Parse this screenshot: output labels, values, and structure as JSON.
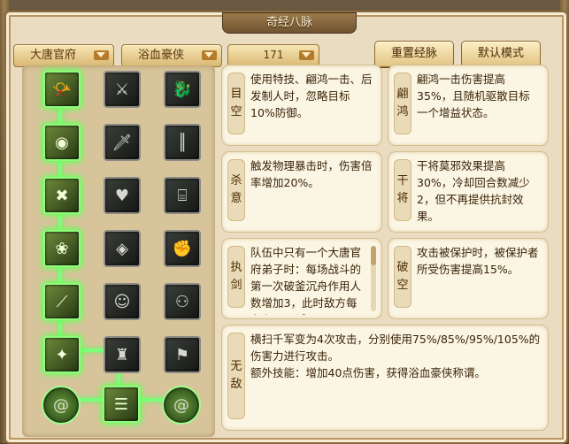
{
  "window": {
    "title": "奇经八脉"
  },
  "controls": {
    "sect": "大唐官府",
    "school": "浴血豪侠",
    "points": "171",
    "reset_label": "重置经脉",
    "default_label": "默认模式"
  },
  "grid": {
    "rows": [
      [
        {
          "icon": "horn-icon",
          "on": true
        },
        {
          "icon": "warrior-icon",
          "on": false
        },
        {
          "icon": "dragon-icon",
          "on": false
        }
      ],
      [
        {
          "icon": "eye-icon",
          "on": true
        },
        {
          "icon": "blade-icon",
          "on": false
        },
        {
          "icon": "bamboo-icon",
          "on": false
        }
      ],
      [
        {
          "icon": "sword-cross-icon",
          "on": true
        },
        {
          "icon": "heart-icon",
          "on": false
        },
        {
          "icon": "maze-icon",
          "on": false
        }
      ],
      [
        {
          "icon": "lotus-icon",
          "on": true
        },
        {
          "icon": "courage-icon",
          "on": false
        },
        {
          "icon": "grip-icon",
          "on": false
        }
      ],
      [
        {
          "icon": "slash-icon",
          "on": true
        },
        {
          "icon": "scholar-icon",
          "on": false
        },
        {
          "icon": "spirit-icon",
          "on": false
        }
      ],
      [
        {
          "icon": "strike-icon",
          "on": true
        },
        {
          "icon": "guardian-icon",
          "on": false
        },
        {
          "icon": "cannon-icon",
          "on": false
        }
      ]
    ],
    "bottom": [
      {
        "icon": "swirl-icon",
        "on": true
      },
      {
        "icon": "stairs-icon",
        "on": true
      },
      {
        "icon": "swirl-icon",
        "on": true
      }
    ]
  },
  "cards": {
    "left": [
      {
        "tag": "目空",
        "text": "使用特技、翩鸿一击、后发制人时，忽略目标10%防御。"
      },
      {
        "tag": "杀意",
        "text": "触发物理暴击时，伤害倍率增加20%。"
      },
      {
        "tag": "执剑",
        "text": "队伍中只有一个大唐官府弟子时：每场战斗的第一次破釜沉舟作用人数增加3，此时敌方每存在一只狐"
      }
    ],
    "right": [
      {
        "tag": "翩鸿",
        "text": "翩鸿一击伤害提高35%，且随机驱散目标一个增益状态。"
      },
      {
        "tag": "干将",
        "text": "干将莫邪效果提高30%，冷却回合数减少2，但不再提供抗封效果。"
      },
      {
        "tag": "破空",
        "text": "攻击被保护时，被保护者所受伤害提高15%。"
      }
    ],
    "bottom": {
      "tag": "无敌",
      "text": "横扫千军变为4次攻击，分别使用75%/85%/95%/105%的伤害力进行攻击。",
      "extra": "额外技能：增加40点伤害，获得浴血豪侠称谓。"
    }
  }
}
